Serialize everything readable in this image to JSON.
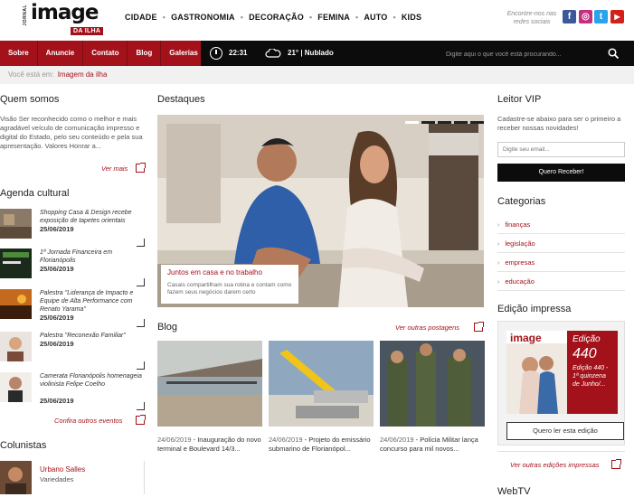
{
  "header": {
    "logo_small": "JORNAL",
    "logo_main": "image",
    "logo_sub": "DA ILHA",
    "nav": [
      "CIDADE",
      "GASTRONOMIA",
      "DECORAÇÃO",
      "FEMINA",
      "AUTO",
      "KIDS"
    ],
    "social_text": "Encontre-nos nas redes sociais",
    "social": [
      {
        "name": "facebook",
        "glyph": "f",
        "color": "#3b5998"
      },
      {
        "name": "instagram",
        "glyph": "◎",
        "color": "#c2307f"
      },
      {
        "name": "twitter",
        "glyph": "t",
        "color": "#2aa3ef"
      },
      {
        "name": "youtube",
        "glyph": "▶",
        "color": "#d1211a"
      }
    ]
  },
  "bar": {
    "links": [
      "Sobre",
      "Anuncie",
      "Contato",
      "Blog",
      "Galerias"
    ],
    "time": "22:31",
    "weather": "21° | Nublado",
    "search_placeholder": "Digite aqui o que você está procurando..."
  },
  "breadcrumb": {
    "prefix": "Você está em:",
    "current": "Imagem da ilha"
  },
  "quem_somos": {
    "heading": "Quem somos",
    "text": "Visão Ser reconhecido como o melhor e mais agradável veículo de comunicação impresso e digital do Estado, pelo seu conteúdo e pela sua apresentação. Valores Honrar a...",
    "more": "Ver mais"
  },
  "agenda": {
    "heading": "Agenda cultural",
    "items": [
      {
        "title": "Shopping Casa & Design recebe exposição de tapetes orientais",
        "date": "25/06/2019"
      },
      {
        "title": "1ª Jornada Financeira em Florianópolis",
        "date": "25/06/2019"
      },
      {
        "title": "Palestra \"Liderança de Impacto e Equipe de Alta Performance com Renato Yarama\"",
        "date": "25/06/2019"
      },
      {
        "title": "Palestra \"Reconexão Familiar\"",
        "date": "25/06/2019"
      },
      {
        "title": "Camerata Florianópolis homenageia violinista Felipe Coelho",
        "date": "25/06/2019"
      }
    ],
    "more": "Confira outros eventos"
  },
  "colunistas": {
    "heading": "Colunistas",
    "name": "Urbano Salles",
    "topic": "Variedades"
  },
  "destaques": {
    "heading": "Destaques",
    "caption_title": "Juntos em casa e no trabalho",
    "caption_text": "Casais compartilham sua rotina e contam como fazem seus negócios darem certo"
  },
  "blog": {
    "heading": "Blog",
    "more": "Ver outras postagens",
    "posts": [
      {
        "date": "24/06/2019",
        "title": "Inauguração do novo terminal e Boulevard 14/3..."
      },
      {
        "date": "24/06/2019",
        "title": "Projeto do emissário submarino de Florianópol..."
      },
      {
        "date": "24/06/2019",
        "title": "Polícia Militar lança concurso para mil novos..."
      }
    ]
  },
  "vip": {
    "heading": "Leitor VIP",
    "text": "Cadastre-se abaixo para ser o primeiro a receber nossas novidades!",
    "email_placeholder": "Digite seu email...",
    "button": "Quero Receber!"
  },
  "categorias": {
    "heading": "Categorias",
    "items": [
      "finanças",
      "legislação",
      "empresas",
      "educação"
    ]
  },
  "edicao": {
    "heading": "Edição impressa",
    "label": "Edição",
    "number": "440",
    "desc": "Edição 440 - 1ª quinzena de Junho/...",
    "cover_title": "image",
    "button": "Quero ler esta edição",
    "more": "Ver outras edições impressas"
  },
  "webtv": {
    "heading": "WebTV"
  }
}
